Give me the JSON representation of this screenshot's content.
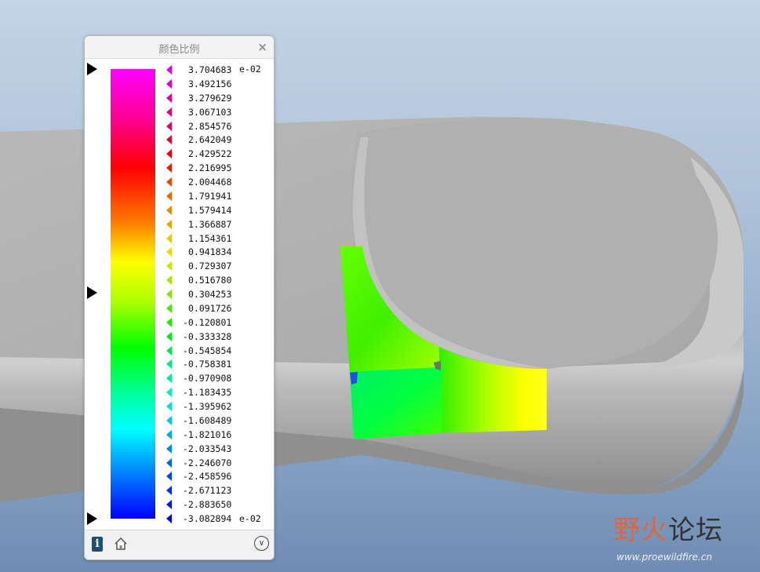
{
  "panel": {
    "title": "颜色比例",
    "close_label": "×"
  },
  "scale": {
    "exponent_top": "e-02",
    "exponent_bottom": "e-02",
    "values": [
      "3.704683",
      "3.492156",
      "3.279629",
      "3.067103",
      "2.854576",
      "2.642049",
      "2.429522",
      "2.216995",
      "2.004468",
      "1.791941",
      "1.579414",
      "1.366887",
      "1.154361",
      "0.941834",
      "0.729307",
      "0.516780",
      "0.304253",
      "0.091726",
      "-0.120801",
      "-0.333328",
      "-0.545854",
      "-0.758381",
      "-0.970908",
      "-1.183435",
      "-1.395962",
      "-1.608489",
      "-1.821016",
      "-2.033543",
      "-2.246070",
      "-2.458596",
      "-2.671123",
      "-2.883650",
      "-3.082894"
    ],
    "tick_colors": [
      "#e000e0",
      "#e000c0",
      "#e000a0",
      "#e00080",
      "#e00060",
      "#e00030",
      "#e00010",
      "#e02000",
      "#e04a00",
      "#e06a00",
      "#e08a00",
      "#e0a800",
      "#e0cc00",
      "#e0e000",
      "#c8e800",
      "#a8e800",
      "#80e800",
      "#50e800",
      "#20e800",
      "#00e820",
      "#00e850",
      "#00e880",
      "#00e8a8",
      "#00e8d0",
      "#00e0e8",
      "#00c8e8",
      "#00a8e8",
      "#0088e8",
      "#0068e8",
      "#0048e8",
      "#0030e8",
      "#0018e8",
      "#0000e8"
    ],
    "colormap": [
      "#ff00ff",
      "#ff0000",
      "#ffff00",
      "#00ff00",
      "#00ffff",
      "#0000ff"
    ]
  },
  "footer": {
    "info_icon": "info-icon",
    "home_icon": "home-icon",
    "expand_icon": "chevron-down-icon",
    "info_glyph": "i",
    "expand_glyph": "∨"
  },
  "watermark": {
    "text_red": "野火",
    "text_dark": "论坛",
    "url": "www.proewildfire.cn"
  }
}
